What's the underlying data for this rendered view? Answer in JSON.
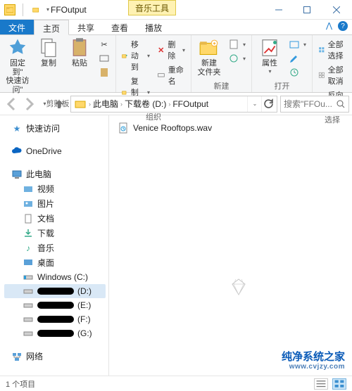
{
  "window": {
    "title": "FFOutput",
    "musicTools": "音乐工具"
  },
  "tabs": {
    "file": "文件",
    "home": "主页",
    "share": "共享",
    "view": "查看",
    "play": "播放"
  },
  "ribbon": {
    "clipboard": {
      "label": "剪贴板",
      "pin": "固定到\"\n快速访问\"",
      "copy": "复制",
      "paste": "粘贴"
    },
    "organize": {
      "label": "组织",
      "moveTo": "移动到",
      "delete": "删除",
      "copyTo": "复制到",
      "rename": "重命名"
    },
    "new": {
      "label": "新建",
      "newFolder": "新建\n文件夹"
    },
    "open": {
      "label": "打开",
      "properties": "属性"
    },
    "select": {
      "label": "选择",
      "selectAll": "全部选择",
      "selectNone": "全部取消",
      "invertSel": "反向选择"
    }
  },
  "breadcrumbs": {
    "p1": "此电脑",
    "p2": "下载卷 (D:)",
    "p3": "FFOutput"
  },
  "search": {
    "placeholder": "搜索\"FFOu..."
  },
  "tree": {
    "quick": "快速访问",
    "onedrive": "OneDrive",
    "thispc": "此电脑",
    "videos": "视频",
    "pictures": "图片",
    "documents": "文档",
    "downloads": "下载",
    "music": "音乐",
    "desktop": "桌面",
    "cdrive": "Windows (C:)",
    "dlabel": "(D:)",
    "elabel": "(E:)",
    "flabel": "(F:)",
    "glabel": "(G:)",
    "network": "网络"
  },
  "file": {
    "name": "Venice Rooftops.wav"
  },
  "status": {
    "itemCount": "1 个项目"
  },
  "brand": {
    "l1": "纯净系统之家",
    "l2": "www.cvjzy.com"
  }
}
